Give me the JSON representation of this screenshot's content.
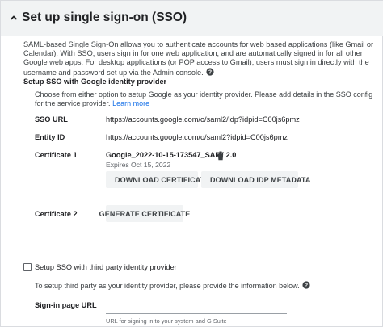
{
  "header": {
    "title": "Set up single sign-on (SSO)"
  },
  "description": "SAML-based Single Sign-On allows you to authenticate accounts for web based applications (like Gmail or Calendar). With SSO, users sign in for one web application, and are automatically signed in for all other Google web apps. For desktop applications (or POP access to Gmail), users must sign in directly with the username and password set up via the Admin console.",
  "google_idp": {
    "section_title": "Setup SSO with Google identity provider",
    "choose_text": "Choose from either option to setup Google as your identity provider. Please add details in the SSO config for the service provider.",
    "learn_more": "Learn more",
    "sso_url_label": "SSO URL",
    "sso_url_value": "https://accounts.google.com/o/saml2/idp?idpid=C00js6pmz",
    "entity_id_label": "Entity ID",
    "entity_id_value": "https://accounts.google.com/o/saml2?idpid=C00js6pmz",
    "certificate1_label": "Certificate 1",
    "certificate1_name": "Google_2022-10-15-173547_SAML2.0",
    "certificate1_expiry": "Expires Oct 15, 2022",
    "download_certificate": "DOWNLOAD CERTIFICATE",
    "download_idp_metadata": "DOWNLOAD IDP METADATA",
    "certificate2_label": "Certificate 2",
    "generate_certificate": "GENERATE CERTIFICATE"
  },
  "third_party": {
    "checkbox_label": "Setup SSO with third party identity provider",
    "checked": false,
    "info_text": "To setup third party as your identity provider, please provide the information below.",
    "signin_label": "Sign-in page URL",
    "signin_value": "",
    "signin_hint": "URL for signing in to your system and G Suite"
  },
  "colors": {
    "header_bg": "#f1f3f4",
    "link": "#1a73e8",
    "button_bg": "#f1f3f4",
    "border": "#dadce0"
  },
  "icons": {
    "collapse": "chevron-up-icon",
    "help": "help-circle-icon",
    "delete": "trash-icon",
    "download": "download-icon"
  }
}
